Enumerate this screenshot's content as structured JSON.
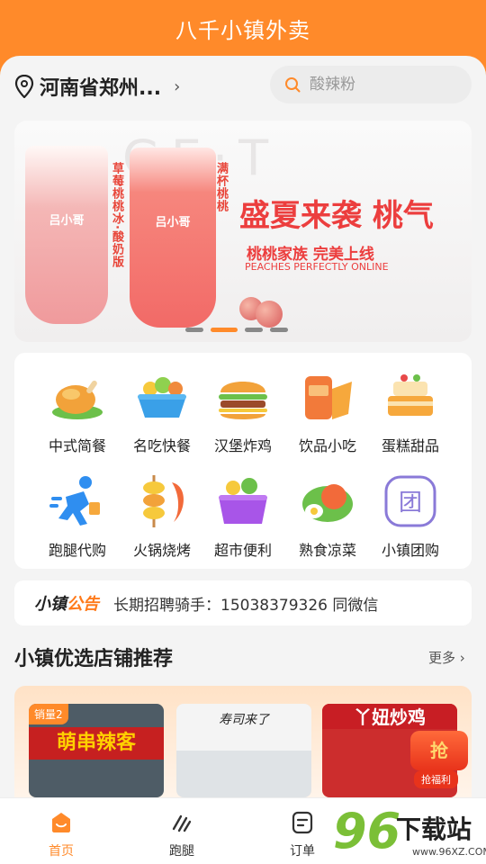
{
  "header": {
    "title": "八千小镇外卖"
  },
  "location": {
    "text": "河南省郑州..."
  },
  "search": {
    "placeholder": "酸辣粉"
  },
  "banner": {
    "bg_text": "GE·T",
    "headline": "盛夏来袭  桃气",
    "subline": "桃桃家族  完美上线",
    "english": "PEACHES PERFECTLY ONLINE",
    "cup_logo": "吕小哥",
    "cup1_label": "草莓桃桃冰·酸奶版",
    "cup2_label": "满杯桃桃",
    "slide_count": 4,
    "active_slide": 2
  },
  "categories": [
    {
      "label": "中式简餐",
      "icon": "roast-chicken-icon"
    },
    {
      "label": "名吃快餐",
      "icon": "salad-bowl-icon"
    },
    {
      "label": "汉堡炸鸡",
      "icon": "burger-icon"
    },
    {
      "label": "饮品小吃",
      "icon": "drink-snack-icon"
    },
    {
      "label": "蛋糕甜品",
      "icon": "cake-icon"
    },
    {
      "label": "跑腿代购",
      "icon": "runner-icon"
    },
    {
      "label": "火锅烧烤",
      "icon": "skewer-icon"
    },
    {
      "label": "超市便利",
      "icon": "basket-icon"
    },
    {
      "label": "熟食凉菜",
      "icon": "cold-dish-icon"
    },
    {
      "label": "小镇团购",
      "icon": "group-buy-icon"
    }
  ],
  "notice": {
    "brand_a": "小镇",
    "brand_b": "公告",
    "text": "长期招聘骑手：15038379326 同微信"
  },
  "section": {
    "title": "小镇优选店铺推荐",
    "more": "更多"
  },
  "shops": [
    {
      "name": "萌串辣客",
      "badge": "销量2"
    },
    {
      "name": "寿司来了"
    },
    {
      "name": "丫妞炒鸡"
    }
  ],
  "promo": {
    "glyph": "抢",
    "label": "抢福利"
  },
  "tabs": [
    {
      "label": "首页",
      "icon": "home-icon",
      "active": true
    },
    {
      "label": "跑腿",
      "icon": "runner-tab-icon",
      "active": false
    },
    {
      "label": "订单",
      "icon": "order-icon",
      "active": false
    }
  ],
  "watermark": {
    "digits": "96",
    "name": "下载站",
    "url": "www.96XZ.COM"
  },
  "colors": {
    "brand": "#ff8a2a",
    "accent_red": "#ec3e3e"
  }
}
